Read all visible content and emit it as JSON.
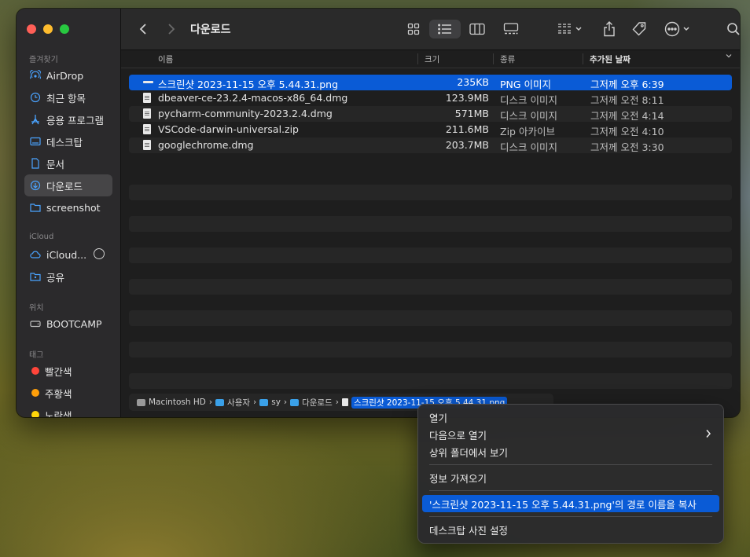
{
  "sidebar": {
    "favorites_label": "즐겨찾기",
    "icloud_label": "iCloud",
    "locations_label": "위치",
    "tags_label": "태그",
    "items": [
      {
        "label": "AirDrop"
      },
      {
        "label": "최근 항목"
      },
      {
        "label": "응용 프로그램"
      },
      {
        "label": "데스크탑"
      },
      {
        "label": "문서"
      },
      {
        "label": "다운로드"
      },
      {
        "label": "screenshot"
      }
    ],
    "icloud_items": [
      {
        "label": "iCloud..."
      },
      {
        "label": "공유"
      }
    ],
    "location_items": [
      {
        "label": "BOOTCAMP"
      }
    ],
    "tags": [
      {
        "label": "빨간색",
        "color": "#ff453a"
      },
      {
        "label": "주황색",
        "color": "#ff9f0a"
      },
      {
        "label": "노란색",
        "color": "#ffd60a"
      }
    ]
  },
  "toolbar": {
    "title": "다운로드"
  },
  "columns": {
    "name": "이름",
    "size": "크기",
    "kind": "종류",
    "date": "추가된 날짜"
  },
  "files": [
    {
      "name": "스크린샷 2023-11-15 오후 5.44.31.png",
      "size": "235KB",
      "kind": "PNG 이미지",
      "date": "그저께 오후 6:39",
      "selected": true
    },
    {
      "name": "dbeaver-ce-23.2.4-macos-x86_64.dmg",
      "size": "123.9MB",
      "kind": "디스크 이미지",
      "date": "그저께 오전 8:11"
    },
    {
      "name": "pycharm-community-2023.2.4.dmg",
      "size": "571MB",
      "kind": "디스크 이미지",
      "date": "그저께 오전 4:14"
    },
    {
      "name": "VSCode-darwin-universal.zip",
      "size": "211.6MB",
      "kind": "Zip 아카이브",
      "date": "그저께 오전 4:10"
    },
    {
      "name": "googlechrome.dmg",
      "size": "203.7MB",
      "kind": "디스크 이미지",
      "date": "그저께 오전 3:30"
    }
  ],
  "pathbar": {
    "segments": [
      "Macintosh HD",
      "사용자",
      "sy",
      "다운로드",
      "스크린샷 2023-11-15 오후 5.44.31.png"
    ]
  },
  "context_menu": {
    "items": [
      {
        "label": "열기"
      },
      {
        "label": "다음으로 열기"
      },
      {
        "label": "상위 폴더에서 보기"
      },
      {
        "label": "정보 가져오기"
      },
      {
        "label": "'스크린샷 2023-11-15 오후 5.44.31.png'의 경로 이름을 복사"
      },
      {
        "label": "데스크탑 사진 설정"
      }
    ]
  },
  "accent_color": "#0a5bd6"
}
